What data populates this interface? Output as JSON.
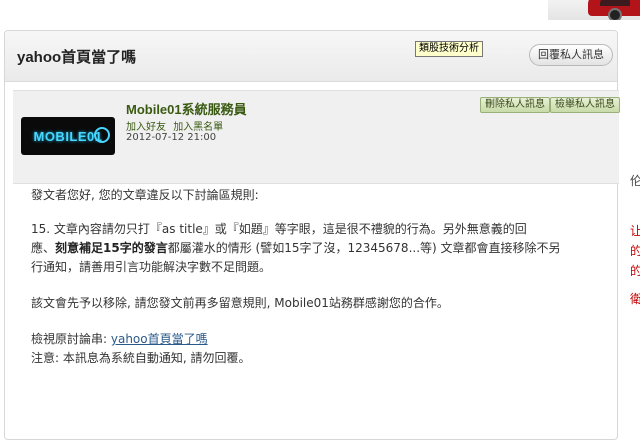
{
  "page": {
    "title": "yahoo首頁當了嗎",
    "reply_button": "回覆私人訊息",
    "tooltip": "類股技術分析"
  },
  "sender": {
    "logo_text": "MOBILE01",
    "name": "Mobile01系統服務員",
    "add_friend": "加入好友",
    "add_blacklist": "加入黑名單",
    "date": "2012-07-12 21:00",
    "delete_button": "刪除私人訊息",
    "report_button": "檢舉私人訊息"
  },
  "message": {
    "greeting": "發文者您好, 您的文章違反以下討論區規則:",
    "rule_line1": "15. 文章內容請勿只打『as title』或『如題』等字眼，這是很不禮貌的行為。另外無意義的回",
    "rule_line2_a": "應、",
    "rule_line2_b": "刻意補足15字的發言",
    "rule_line2_c": "都屬灌水的情形 (譬如15字了沒，12345678...等) 文章都會直接移除不另",
    "rule_line3": "行通知，請善用引言功能解決字數不足問題。",
    "removal_notice": "該文會先予以移除, 請您發文前再多留意規則, Mobile01站務群感謝您的合作。",
    "view_prefix": "檢視原討論串: ",
    "view_link": "yahoo首頁當了嗎",
    "note": "注意: 本訊息為系統自動通知, 請勿回覆。"
  },
  "edge": {
    "frag_1": "伦",
    "frag_2": "让",
    "frag_3": "的",
    "frag_4": "的",
    "frag_5": "衛"
  },
  "colors": {
    "accent_green": "#3a5a12",
    "link_blue": "#2a5a8a",
    "logo_cyan": "#47d7ff"
  }
}
